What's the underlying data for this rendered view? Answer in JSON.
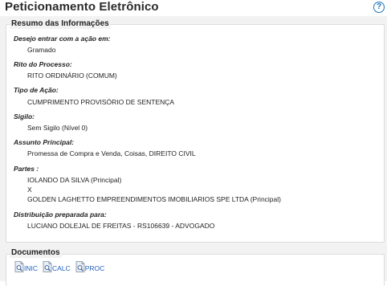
{
  "header": {
    "title": "Peticionamento Eletrônico",
    "help_glyph": "?"
  },
  "summary": {
    "legend": "Resumo das Informações",
    "fields": [
      {
        "label": "Desejo entrar com a ação em:",
        "values": [
          "Gramado"
        ]
      },
      {
        "label": "Rito do Processo:",
        "values": [
          "RITO ORDINÁRIO (COMUM)"
        ]
      },
      {
        "label": "Tipo de Ação:",
        "values": [
          "CUMPRIMENTO PROVISÓRIO DE SENTENÇA"
        ]
      },
      {
        "label": "Sigilo:",
        "values": [
          "Sem Sigilo (Nível 0)"
        ]
      },
      {
        "label": "Assunto Principal:",
        "values": [
          "Promessa de Compra e Venda, Coisas, DIREITO CIVIL"
        ]
      },
      {
        "label": "Partes :",
        "values": [
          "IOLANDO DA SILVA (Principal)",
          "X",
          "GOLDEN LAGHETTO EMPREENDIMENTOS IMOBILIARIOS SPE LTDA (Principal)"
        ]
      },
      {
        "label": "Distribuição preparada para:",
        "values": [
          "LUCIANO DOLEJAL DE FREITAS - RS106639 - ADVOGADO"
        ]
      }
    ]
  },
  "documents": {
    "legend": "Documentos",
    "items": [
      {
        "label": "INIC",
        "icon": "document-search-icon"
      },
      {
        "label": "CALC",
        "icon": "document-search-icon"
      },
      {
        "label": "PROC",
        "icon": "document-search-icon"
      }
    ]
  },
  "colors": {
    "link": "#1f5fbf",
    "help": "#1f73b7",
    "panel_bg": "#f2f2f2"
  }
}
